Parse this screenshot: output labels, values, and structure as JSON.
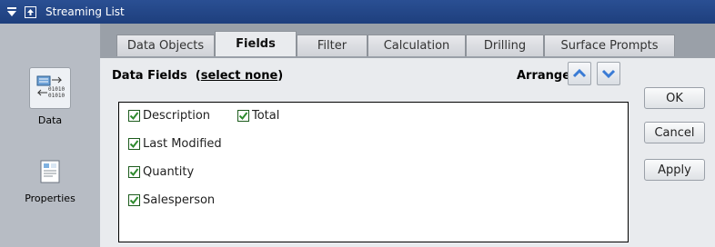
{
  "window": {
    "title": "Streaming List"
  },
  "nav": {
    "data_label": "Data",
    "properties_label": "Properties"
  },
  "tabs": [
    {
      "label": "Data Objects"
    },
    {
      "label": "Fields"
    },
    {
      "label": "Filter"
    },
    {
      "label": "Calculation"
    },
    {
      "label": "Drilling"
    },
    {
      "label": "Surface Prompts"
    }
  ],
  "active_tab": "Fields",
  "fields_panel": {
    "title": "Data Fields",
    "select_none_label": "select none",
    "arrange_label": "Arrange",
    "fields": [
      {
        "label": "Description",
        "checked": true
      },
      {
        "label": "Total",
        "checked": true
      },
      {
        "label": "Last Modified",
        "checked": true
      },
      {
        "label": "Quantity",
        "checked": true
      },
      {
        "label": "Salesperson",
        "checked": true
      }
    ]
  },
  "buttons": {
    "ok": "OK",
    "cancel": "Cancel",
    "apply": "Apply"
  },
  "colors": {
    "titlebar": "#1e3f7d",
    "check": "#2e8b2e",
    "arrow": "#3a7bd5"
  }
}
